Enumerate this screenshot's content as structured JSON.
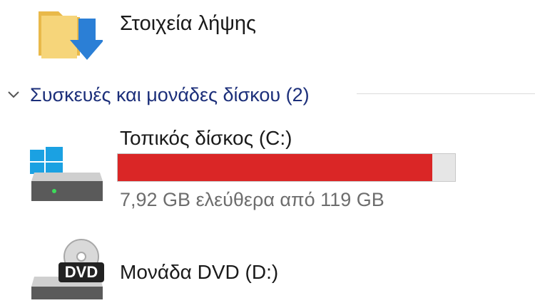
{
  "downloads": {
    "label": "Στοιχεία λήψης",
    "icon": "downloads-folder-icon"
  },
  "section": {
    "title": "Συσκευές και μονάδες δίσκου (2)",
    "icon": "chevron-down-icon"
  },
  "drives": [
    {
      "name": "Τοπικός δίσκος (C:)",
      "space": "7,92 GB ελεύθερα από 119 GB",
      "used_fraction": 0.933,
      "bar_color": "#da2626",
      "icon": "windows-drive-icon"
    },
    {
      "name": "Μονάδα DVD (D:)",
      "icon": "dvd-drive-icon",
      "icon_text": "DVD"
    }
  ]
}
